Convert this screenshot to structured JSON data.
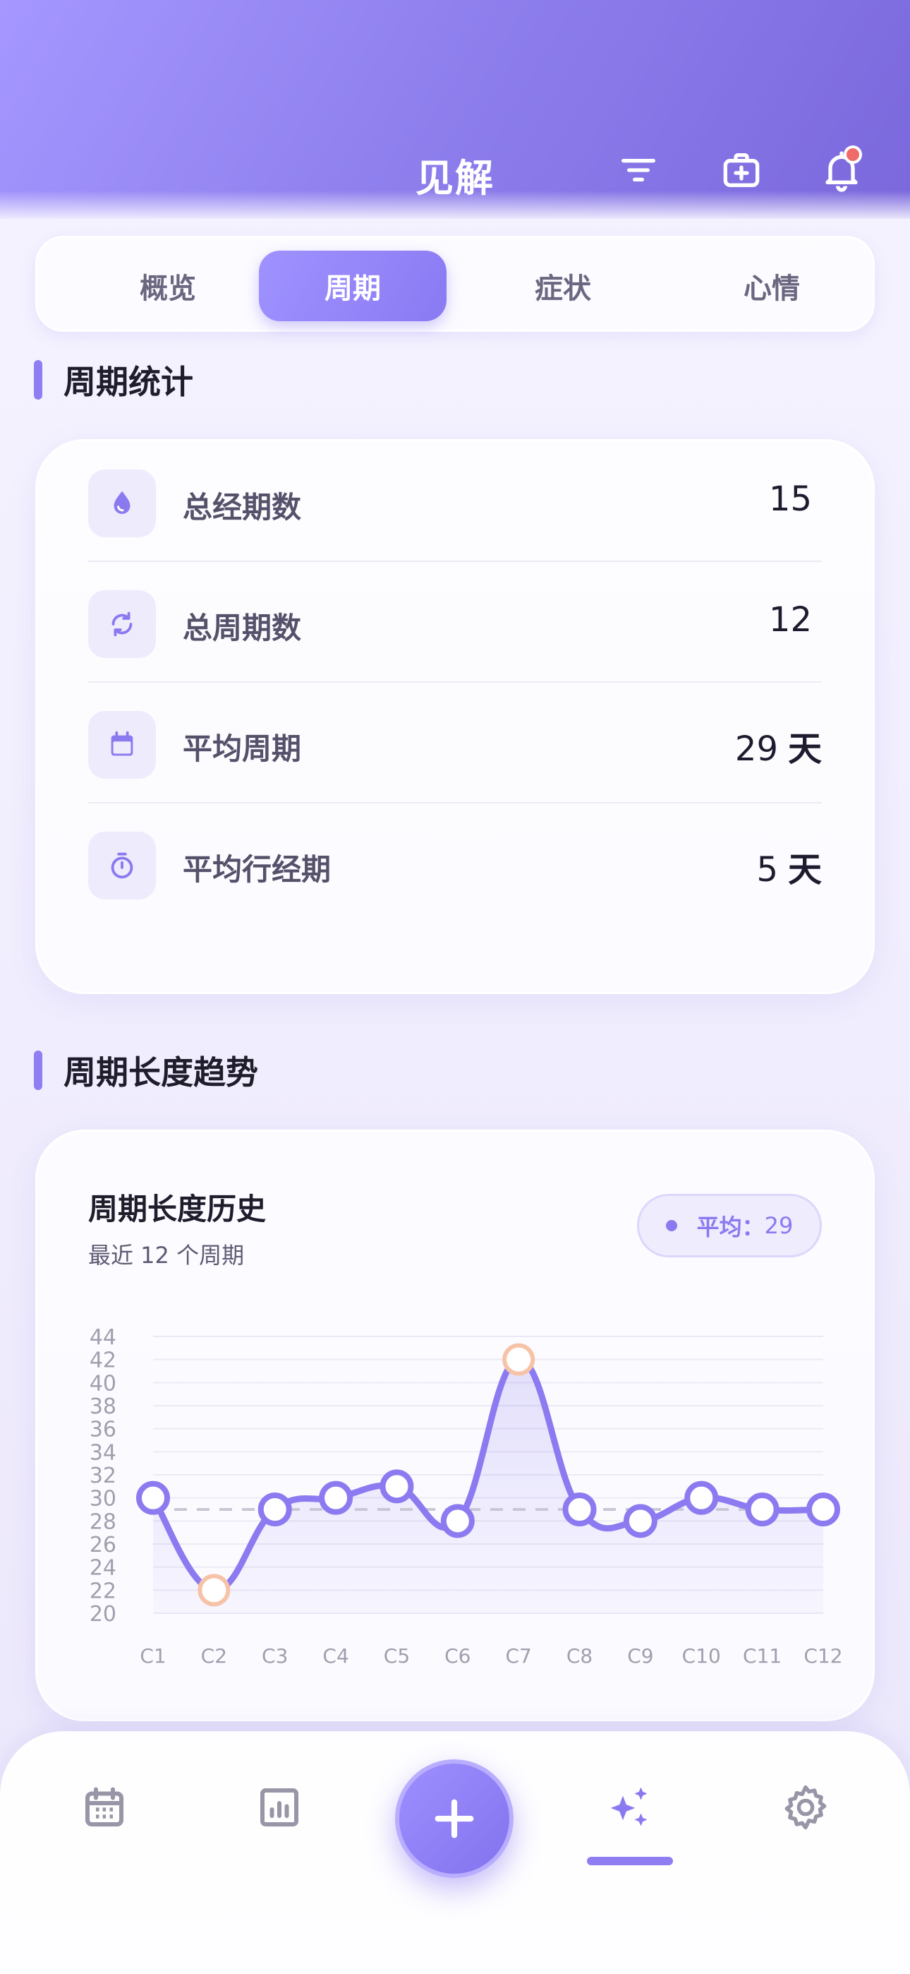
{
  "header": {
    "title": "见解",
    "icons": [
      "filter-icon",
      "medical-kit-icon",
      "bell-icon"
    ],
    "has_notification": true
  },
  "tabs": [
    {
      "label": "概览",
      "active": false
    },
    {
      "label": "周期",
      "active": true
    },
    {
      "label": "症状",
      "active": false
    },
    {
      "label": "心情",
      "active": false
    }
  ],
  "stats_section": {
    "title": "周期统计",
    "rows": [
      {
        "icon": "drop-icon",
        "label": "总经期数",
        "value": "15",
        "unit": ""
      },
      {
        "icon": "cycle-icon",
        "label": "总周期数",
        "value": "12",
        "unit": ""
      },
      {
        "icon": "calendar-icon",
        "label": "平均周期",
        "value": "29",
        "unit": "天"
      },
      {
        "icon": "timer-icon",
        "label": "平均行经期",
        "value": "5",
        "unit": "天"
      }
    ]
  },
  "trend_section": {
    "title": "周期长度趋势",
    "card_title": "周期长度历史",
    "card_subtitle": "最近 12 个周期",
    "avg_label": "平均：",
    "avg_value": "29"
  },
  "chart_data": {
    "type": "line",
    "x": [
      "C1",
      "C2",
      "C3",
      "C4",
      "C5",
      "C6",
      "C7",
      "C8",
      "C9",
      "C10",
      "C11",
      "C12"
    ],
    "values": [
      30,
      22,
      29,
      30,
      31,
      28,
      42,
      29,
      28,
      30,
      29,
      29
    ],
    "highlighted": [
      "C2",
      "C7"
    ],
    "average": 29,
    "ylim": [
      20,
      44
    ],
    "yticks": [
      20,
      22,
      24,
      26,
      28,
      30,
      32,
      34,
      36,
      38,
      40,
      42,
      44
    ],
    "grid": true,
    "colors": {
      "line": "#8c7bf0",
      "highlight": "#f7c3a8",
      "average": "#c9c6d6"
    }
  },
  "bottom_nav": {
    "items": [
      "calendar-icon",
      "chart-icon",
      "add-icon",
      "sparkle-icon",
      "gear-icon"
    ],
    "active": "sparkle-icon"
  },
  "colors": {
    "accent": "#8e7ef2",
    "header_start": "#a597ff",
    "header_end": "#7a68dc"
  }
}
